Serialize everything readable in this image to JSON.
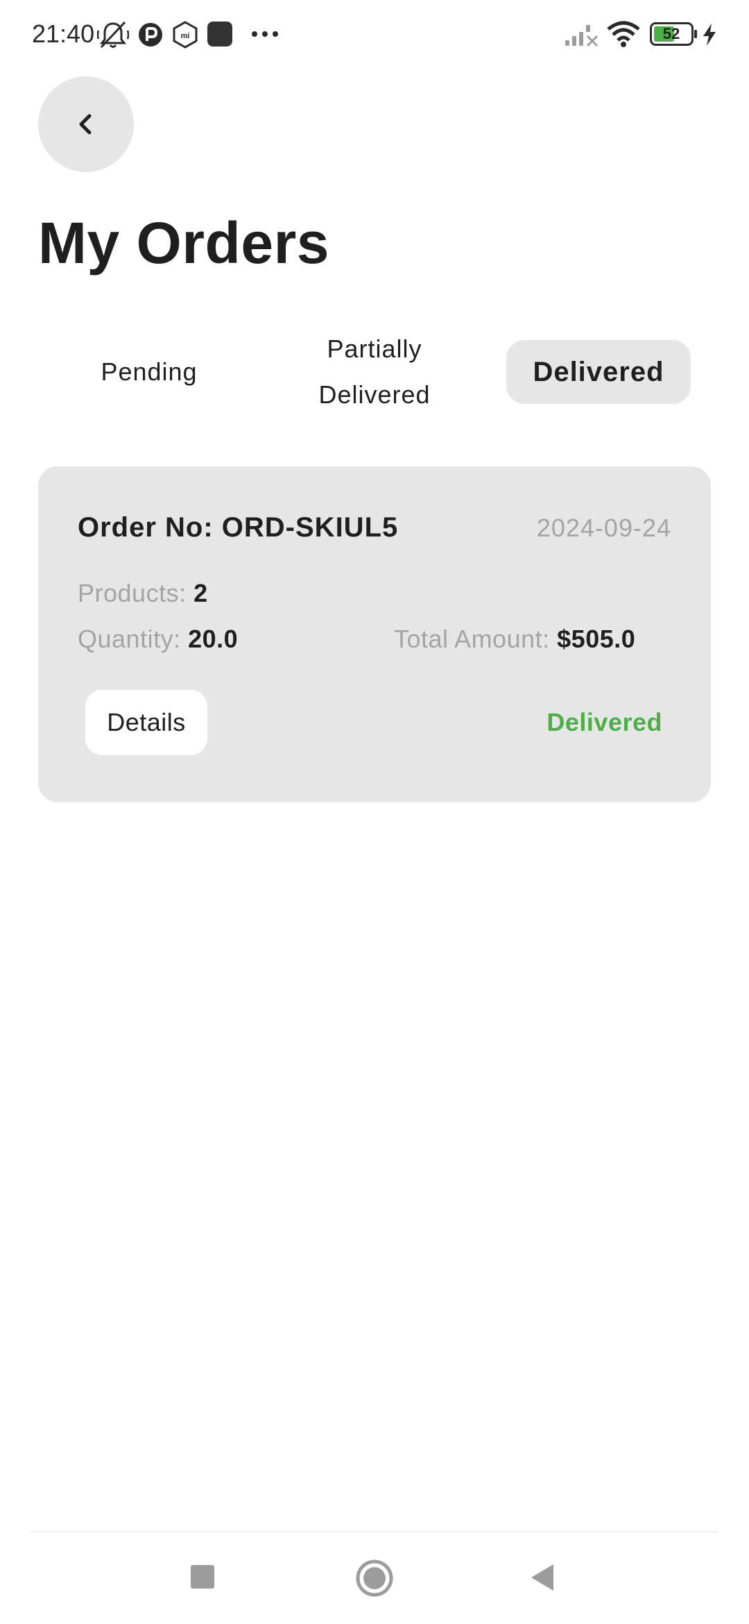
{
  "status_bar": {
    "time": "21:40",
    "battery_level": "52",
    "icons": [
      "mute-icon",
      "app-icon",
      "mi-icon",
      "square-app-icon",
      "more-dots-icon",
      "signal-icon",
      "wifi-icon",
      "battery-icon",
      "charging-icon"
    ]
  },
  "header": {
    "back_icon": "chevron-left-icon",
    "title": "My Orders"
  },
  "tabs": [
    {
      "label": "Pending",
      "selected": false
    },
    {
      "label": "Partially Delivered",
      "selected": false
    },
    {
      "label": "Delivered",
      "selected": true
    }
  ],
  "orders": [
    {
      "order_no": "Order No: ORD-SKIUL5",
      "date": "2024-09-24",
      "products_label": "Products:",
      "products_value": "2",
      "quantity_label": "Quantity:",
      "quantity_value": "20.0",
      "total_label": "Total Amount:",
      "total_value": "$505.0",
      "details_button": "Details",
      "status": "Delivered"
    }
  ],
  "colors": {
    "card_background": "#e6e6e6",
    "status_delivered": "#4caf47",
    "muted_text": "#a4a4a4",
    "primary_text": "#1f1f1f"
  },
  "navigation_bar": {
    "buttons": [
      "recents-icon",
      "home-icon",
      "back-triangle-icon"
    ]
  }
}
